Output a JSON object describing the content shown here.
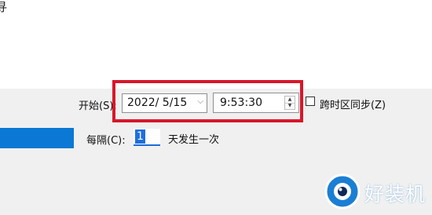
{
  "header": {
    "partial_title_glyph": "寻"
  },
  "trigger": {
    "start_label": "开始(S):",
    "start_date": "2022/  5/15",
    "start_time": "9:53:30",
    "sync_timezone_label": "跨时区同步(Z)",
    "sync_timezone_checked": false,
    "interval_label": "每隔(C):",
    "interval_value": "1",
    "interval_suffix": "天发生一次"
  },
  "watermark": {
    "text": "好装机"
  },
  "colors": {
    "highlight": "#d9162a",
    "selection_blue": "#0a78d4",
    "field_border": "#8f8f8f"
  }
}
